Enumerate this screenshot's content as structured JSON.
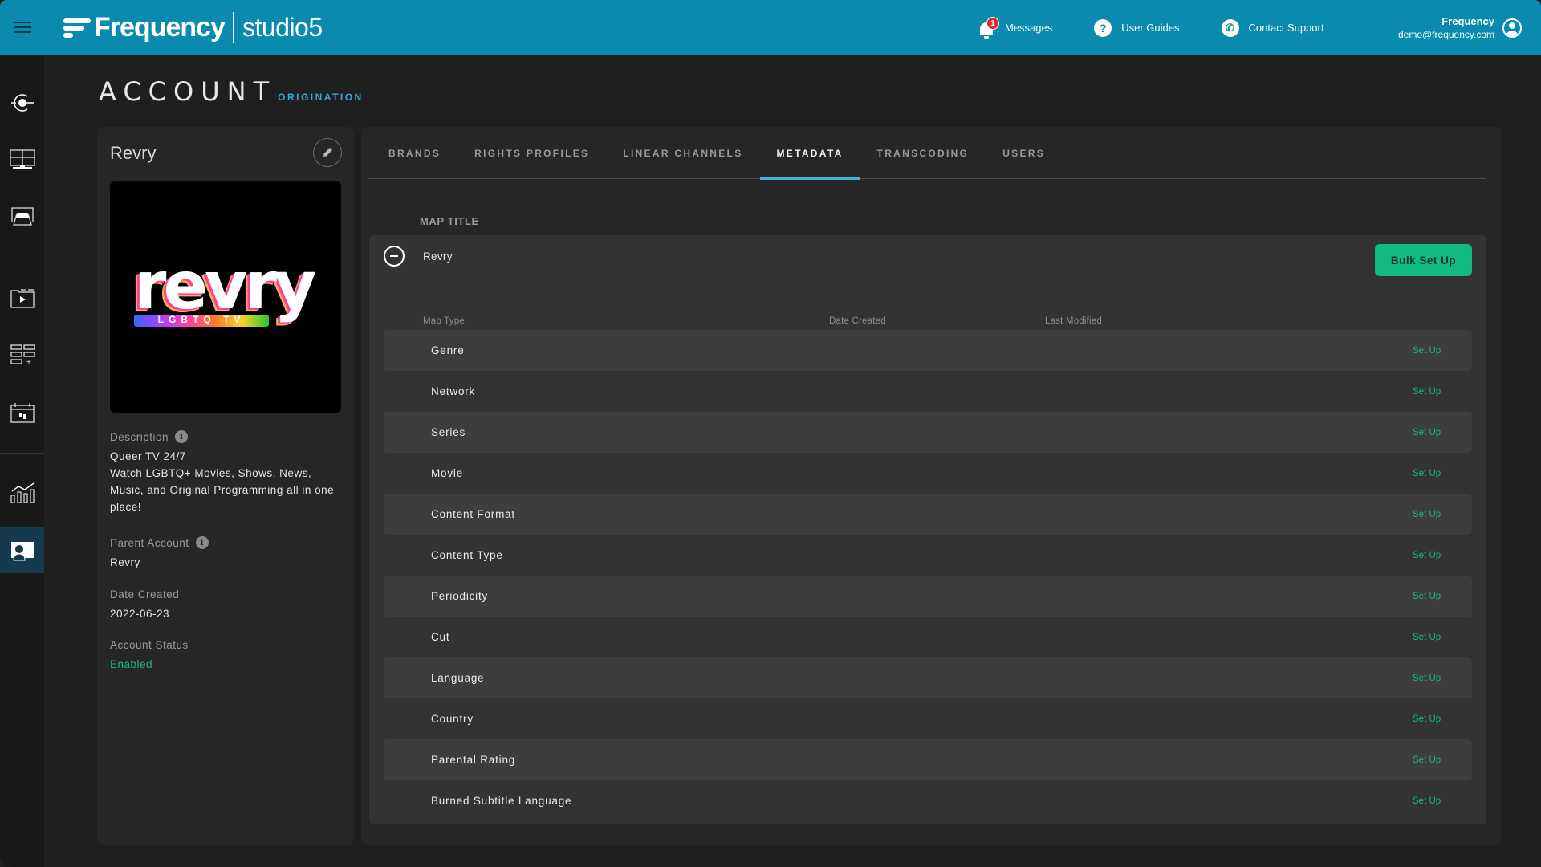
{
  "header": {
    "brand_name": "Frequency",
    "product_name": "studio5",
    "messages_label": "Messages",
    "messages_badge": "1",
    "user_guides_label": "User Guides",
    "contact_support_label": "Contact Support",
    "user_name": "Frequency",
    "user_email": "demo@frequency.com",
    "accent_color": "#0a8aae"
  },
  "sidebar": {
    "items": [
      {
        "icon": "origination-icon",
        "active": false
      },
      {
        "icon": "monitor-grid-icon",
        "active": false
      },
      {
        "icon": "device-icon",
        "active": false
      },
      {
        "icon": "media-folder-icon",
        "active": false
      },
      {
        "icon": "layout-add-icon",
        "active": false
      },
      {
        "icon": "calendar-icon",
        "active": false
      },
      {
        "icon": "analytics-icon",
        "active": false
      },
      {
        "icon": "account-icon",
        "active": true
      }
    ]
  },
  "page": {
    "title": "ACCOUNT",
    "subtitle": "ORIGINATION"
  },
  "account": {
    "name": "Revry",
    "logo_text": "revry",
    "logo_tagline": "LGBTQ TV",
    "description_label": "Description",
    "description_line1": "Queer TV 24/7",
    "description_line2": "Watch LGBTQ+ Movies, Shows, News, Music, and Original Programming all in one place!",
    "parent_account_label": "Parent Account",
    "parent_account_value": "Revry",
    "date_created_label": "Date Created",
    "date_created_value": "2022-06-23",
    "account_status_label": "Account Status",
    "account_status_value": "Enabled",
    "status_color": "#14b981"
  },
  "tabs": [
    {
      "label": "BRANDS",
      "active": false
    },
    {
      "label": "RIGHTS PROFILES",
      "active": false
    },
    {
      "label": "LINEAR CHANNELS",
      "active": false
    },
    {
      "label": "METADATA",
      "active": true
    },
    {
      "label": "TRANSCODING",
      "active": false
    },
    {
      "label": "USERS",
      "active": false
    }
  ],
  "metadata": {
    "map_title_label": "MAP TITLE",
    "map_name": "Revry",
    "bulk_setup_label": "Bulk Set Up",
    "columns": {
      "map_type": "Map Type",
      "date_created": "Date Created",
      "last_modified": "Last Modified"
    },
    "rows": [
      {
        "map_type": "Genre",
        "date_created": "",
        "last_modified": "",
        "action": "Set Up"
      },
      {
        "map_type": "Network",
        "date_created": "",
        "last_modified": "",
        "action": "Set Up"
      },
      {
        "map_type": "Series",
        "date_created": "",
        "last_modified": "",
        "action": "Set Up"
      },
      {
        "map_type": "Movie",
        "date_created": "",
        "last_modified": "",
        "action": "Set Up"
      },
      {
        "map_type": "Content Format",
        "date_created": "",
        "last_modified": "",
        "action": "Set Up"
      },
      {
        "map_type": "Content Type",
        "date_created": "",
        "last_modified": "",
        "action": "Set Up"
      },
      {
        "map_type": "Periodicity",
        "date_created": "",
        "last_modified": "",
        "action": "Set Up"
      },
      {
        "map_type": "Cut",
        "date_created": "",
        "last_modified": "",
        "action": "Set Up"
      },
      {
        "map_type": "Language",
        "date_created": "",
        "last_modified": "",
        "action": "Set Up"
      },
      {
        "map_type": "Country",
        "date_created": "",
        "last_modified": "",
        "action": "Set Up"
      },
      {
        "map_type": "Parental Rating",
        "date_created": "",
        "last_modified": "",
        "action": "Set Up"
      },
      {
        "map_type": "Burned Subtitle Language",
        "date_created": "",
        "last_modified": "",
        "action": "Set Up"
      }
    ],
    "action_color": "#12b981"
  }
}
